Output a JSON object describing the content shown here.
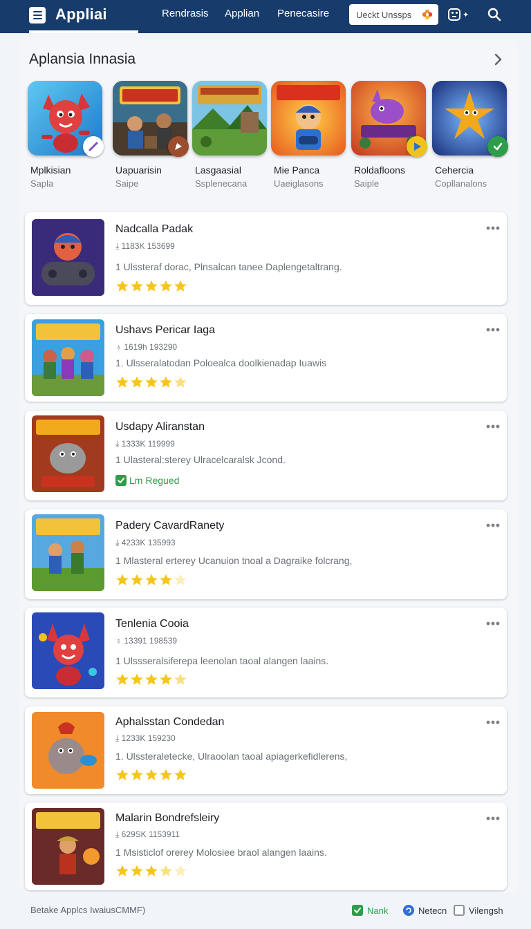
{
  "header": {
    "app_name": "Appliai",
    "nav_tabs": [
      "Rendrasis",
      "Applian",
      "Penecasire"
    ],
    "search_placeholder": "Ueckt Unssps"
  },
  "featured": {
    "title": "Aplansia Innasia",
    "tiles": [
      {
        "name": "Mplkisian",
        "sub": "Sapla"
      },
      {
        "name": "Uapuarisin",
        "sub": "Saipe"
      },
      {
        "name": "Lasgaasial",
        "sub": "Ssplenecana"
      },
      {
        "name": "Mie Panca",
        "sub": "Uaeiglasons"
      },
      {
        "name": "Roldafloons",
        "sub": "Saiple"
      },
      {
        "name": "Cehercia",
        "sub": "Copllanalons"
      }
    ]
  },
  "apps": [
    {
      "title": "Nadcalla Padak",
      "meta": "1183K 153699",
      "meta_icon": "download-icon",
      "desc": "1 Ulssteraf dorac, Plnsalcan tanee Daplengetaltrang.",
      "rating": 5
    },
    {
      "title": "Ushavs Pericar Iaga",
      "meta": "1619h 193290",
      "meta_icon": "user-icon",
      "desc": "1. Ulsseralatodan Poloealca doolkienadap Iuawis",
      "rating": 4.5
    },
    {
      "title": "Usdapy Aliranstan",
      "meta": "1333K 119999",
      "meta_icon": "download-icon",
      "desc": "1 Ulasteral:sterey Ulracelcaralsk Jcond.",
      "status": "Lm Regued"
    },
    {
      "title": "Padery CavardRanety",
      "meta": "4233K 135993",
      "meta_icon": "download-icon",
      "desc": "1 Mlasteral erterey Ucanuion tnoal a Dagraike folcrang,",
      "rating": 4
    },
    {
      "title": "Tenlenia Cooia",
      "meta": "13391 198539",
      "meta_icon": "user-icon",
      "desc": "1 Ulssseralsiferepa leenolan taoal alangen laains.",
      "rating": 4.5
    },
    {
      "title": "Aphalsstan Condedan",
      "meta": "1233K 159230",
      "meta_icon": "download-icon",
      "desc": "1. Ulssteraletecke, Ulraoolan taoal apiagerkefidlerens,",
      "rating": 5
    },
    {
      "title": "Malarin Bondrefsleiry",
      "meta": "629SK 1153911",
      "meta_icon": "download-icon",
      "desc": "1 Msisticlof orerey Molosiee braol alangen laains.",
      "rating": 3.5
    }
  ],
  "footer": {
    "left": "Betake   Applcs IwaiusCMMF)",
    "items": [
      {
        "label": "Nank",
        "color": "#2e9d4a"
      },
      {
        "label": "Netecn",
        "color": "#2f6fd1"
      },
      {
        "label": "Vilengsh",
        "color": "#8c9097"
      }
    ]
  },
  "colors": {
    "header_bg": "#173c6b",
    "star": "#f5c518",
    "success": "#2e9d4a"
  }
}
